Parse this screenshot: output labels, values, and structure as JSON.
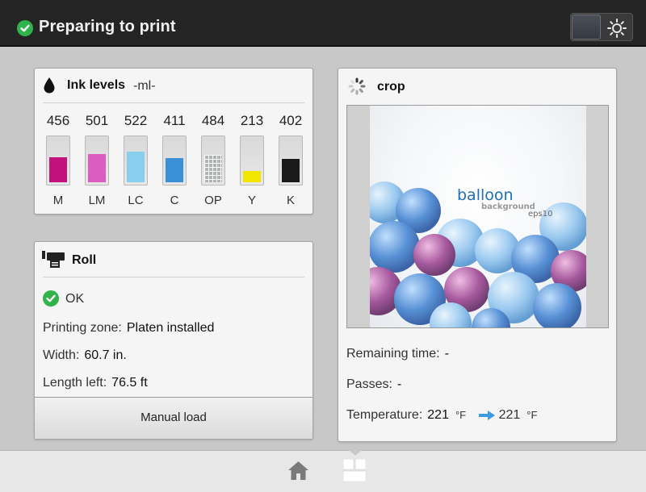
{
  "header": {
    "status_title": "Preparing to print",
    "status_color": "#2fb34a"
  },
  "ink": {
    "title": "Ink levels",
    "unit": "-ml-",
    "cartridges": [
      {
        "name": "M",
        "value": "456",
        "level": 0.55,
        "color": "#c2107d"
      },
      {
        "name": "LM",
        "value": "501",
        "level": 0.62,
        "color": "#dc5cc2"
      },
      {
        "name": "LC",
        "value": "522",
        "level": 0.68,
        "color": "#88cfee"
      },
      {
        "name": "C",
        "value": "411",
        "level": 0.53,
        "color": "#3a8fd6"
      },
      {
        "name": "OP",
        "value": "484",
        "level": 0.6,
        "color": "#aeb4b4"
      },
      {
        "name": "Y",
        "value": "213",
        "level": 0.25,
        "color": "#f2e600"
      },
      {
        "name": "K",
        "value": "402",
        "level": 0.52,
        "color": "#1a1a1a"
      }
    ]
  },
  "roll": {
    "title": "Roll",
    "status": "OK",
    "printing_zone_label": "Printing zone:",
    "printing_zone_value": "Platen installed",
    "width_label": "Width:",
    "width_value": "60.7 in.",
    "length_label": "Length left:",
    "length_value": "76.5 ft",
    "manual_load_label": "Manual load"
  },
  "job": {
    "title": "crop",
    "preview_title": "balloon",
    "preview_subtitle": "background",
    "preview_format": "eps10",
    "remaining_label": "Remaining time:",
    "remaining_value": "-",
    "passes_label": "Passes:",
    "passes_value": "-",
    "temperature_label": "Temperature:",
    "temperature_from": "221",
    "temperature_to": "221",
    "temperature_unit": "°F"
  },
  "nav": {
    "items": [
      "home-icon",
      "dashboard-icon"
    ],
    "active": "dashboard-icon"
  }
}
